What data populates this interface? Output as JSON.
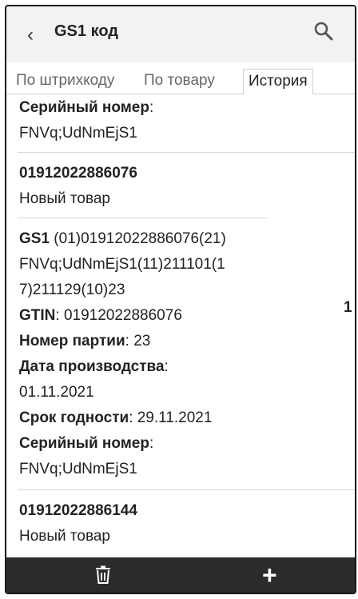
{
  "appbar": {
    "back_icon": "‹",
    "title": "GS1 код"
  },
  "tabs": [
    {
      "label": "По штрихкоду"
    },
    {
      "label": "По товару"
    },
    {
      "label": "История"
    }
  ],
  "top_item": {
    "serial_label": "Серийный номер",
    "serial_value": "FNVq;UdNmEjS1"
  },
  "item1": {
    "code": "01912022886076",
    "status": "Новый товар"
  },
  "detail": {
    "gs1_label": "GS1",
    "gs1_line1": " (01)01912022886076(21)",
    "gs1_line2": "FNVq;UdNmEjS1(11)211101(1",
    "gs1_line3": "7)211129(10)23",
    "gtin_label": "GTIN",
    "gtin_value": ": 01912022886076",
    "batch_label": "Номер партии",
    "batch_value": ": 23",
    "prod_label": "Дата производства",
    "prod_colon": ":",
    "prod_value": "01.11.2021",
    "exp_label": "Срок годности",
    "exp_value": ": 29.11.2021",
    "serial_label": "Серийный номер",
    "serial_colon": ":",
    "serial_value": "FNVq;UdNmEjS1",
    "quantity": "1"
  },
  "item2": {
    "code": "01912022886144",
    "status": "Новый товар"
  },
  "bottombar": {
    "delete_icon": "trash-icon",
    "add_label": "+"
  }
}
